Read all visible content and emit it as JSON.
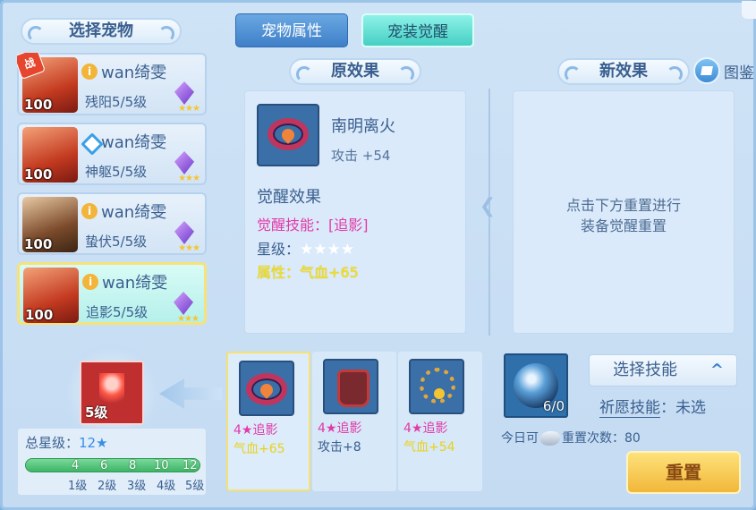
{
  "left_panel": {
    "title": "选择宠物",
    "pets": [
      {
        "name": "wan绮雯",
        "level": "100",
        "skill": "残阳5/5级",
        "battle_badge": "战",
        "stars": "★★★"
      },
      {
        "name": "wan绮雯",
        "level": "100",
        "skill": "神躯5/5级",
        "stars": "★★★"
      },
      {
        "name": "wan绮雯",
        "level": "100",
        "skill": "蛰伏5/5级",
        "stars": "★★★"
      },
      {
        "name": "wan绮雯",
        "level": "100",
        "skill": "追影5/5级",
        "stars": "★★★"
      }
    ]
  },
  "tabs": {
    "attr": "宠物属性",
    "awaken": "宠装觉醒"
  },
  "original": {
    "title": "原效果",
    "equip_name": "南明离火",
    "equip_stat": "攻击 +54",
    "awaken_title": "觉醒效果",
    "awaken_skill": "觉醒技能：[追影]",
    "star_label": "星级：",
    "stars": "★★★★",
    "attr": "属性：气血+65"
  },
  "new_effect": {
    "title": "新效果",
    "hint_line1": "点击下方重置进行",
    "hint_line2": "装备觉醒重置"
  },
  "gallery": {
    "label": "图鉴"
  },
  "skill_slot": {
    "level": "5级"
  },
  "total_stars": {
    "label": "总星级：",
    "value": "12★",
    "ticks": [
      "4",
      "6",
      "8",
      "10",
      "12"
    ],
    "levels": [
      "1级",
      "2级",
      "3级",
      "4级",
      "5级"
    ]
  },
  "candidates": [
    {
      "skill": "4★追影",
      "stat": "气血+65",
      "stat_color": "yellow"
    },
    {
      "skill": "4★追影",
      "stat": "攻击+8",
      "stat_color": "blue"
    },
    {
      "skill": "4★追影",
      "stat": "气血+54",
      "stat_color": "yellow"
    }
  ],
  "orb": {
    "count": "6/0"
  },
  "select_skill": {
    "label": "选择技能",
    "chevron": "^"
  },
  "pray": {
    "label": "祈愿技能",
    "value": "：未选"
  },
  "reset_info": {
    "prefix": "今日可",
    "text": "重置次数：80"
  },
  "reset_button": {
    "label": "重置"
  },
  "colors": {
    "accent": "#46cfc4",
    "pink": "#e23aa8",
    "yellow": "#f5e01c",
    "button": "#f2b73a"
  }
}
